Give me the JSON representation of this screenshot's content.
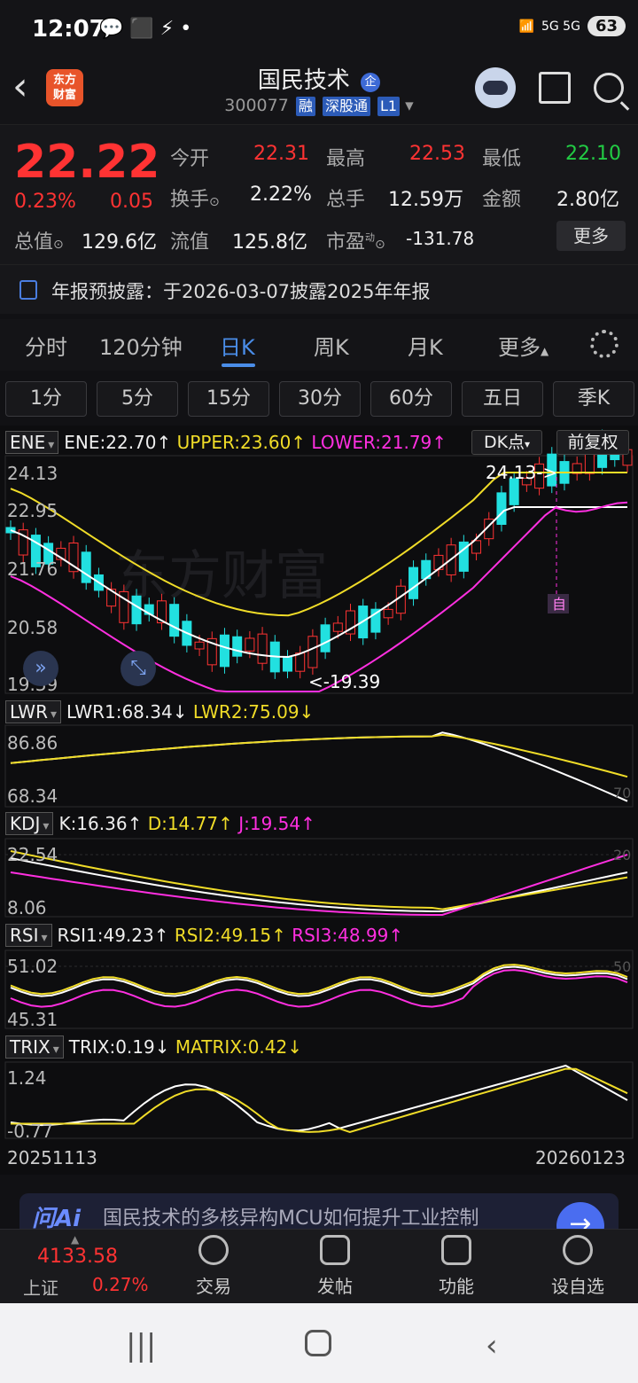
{
  "status_bar": {
    "time": "12:07",
    "left_icons": "💬 ⬛ ⚡ •",
    "network": "5G 5G",
    "battery": "63"
  },
  "header": {
    "logo_line1": "东方",
    "logo_line2": "财富",
    "stock_name": "国民技术",
    "stock_badge": "企",
    "stock_code": "300077",
    "tags": [
      "融",
      "深股通",
      "L1"
    ]
  },
  "quote": {
    "price": "22.22",
    "change_pct": "0.23%",
    "change": "0.05",
    "open_label": "今开",
    "open": "22.31",
    "high_label": "最高",
    "high": "22.53",
    "low_label": "最低",
    "low": "22.10",
    "turnover_label": "换手",
    "turnover": "2.22%",
    "volume_label": "总手",
    "volume": "12.59万",
    "amount_label": "金额",
    "amount": "2.80亿",
    "mcap_label": "总值",
    "mcap": "129.6亿",
    "float_label": "流值",
    "float": "125.8亿",
    "pe_label": "市盈",
    "pe_sup": "动",
    "pe": "-131.78",
    "more": "更多"
  },
  "notice": {
    "text": "年报预披露：于2026-03-07披露2025年年报"
  },
  "tabs": [
    "分时",
    "120分钟",
    "日K",
    "周K",
    "月K",
    "更多"
  ],
  "active_tab": "日K",
  "periods": [
    "1分",
    "5分",
    "15分",
    "30分",
    "60分",
    "五日",
    "季K"
  ],
  "indicators": {
    "ene": {
      "name": "ENE",
      "ene": "ENE:22.70↑",
      "upper": "UPPER:23.60↑",
      "lower": "LOWER:21.79↑",
      "dk": "DK点",
      "fq": "前复权"
    },
    "lwr": {
      "name": "LWR",
      "lwr1": "LWR1:68.34↓",
      "lwr2": "LWR2:75.09↓"
    },
    "kdj": {
      "name": "KDJ",
      "k": "K:16.36↑",
      "d": "D:14.77↑",
      "j": "J:19.54↑"
    },
    "rsi": {
      "name": "RSI",
      "rsi1": "RSI1:49.23↑",
      "rsi2": "RSI2:49.15↑",
      "rsi3": "RSI3:48.99↑"
    },
    "trix": {
      "name": "TRIX",
      "trix": "TRIX:0.19↓",
      "matrix": "MATRIX:0.42↓"
    }
  },
  "axis": {
    "price": [
      "24.13",
      "22.95",
      "21.76",
      "20.58",
      "19.39"
    ],
    "lwr": [
      "86.86",
      "68.34"
    ],
    "lwr_right": "70",
    "kdj": [
      "22.54",
      "8.06"
    ],
    "kdj_right": "20",
    "rsi": [
      "51.02",
      "45.31"
    ],
    "rsi_right": "50",
    "trix": [
      "1.24",
      "-0.77"
    ],
    "date_start": "20251113",
    "date_end": "20260123",
    "max_label": "24.13->",
    "min_label": "<-19.39",
    "self_marker": "自",
    "watermark": "东方财富"
  },
  "ai": {
    "logo": "问Ai",
    "text": "国民技术的多核异构MCU如何提升工业控制"
  },
  "bottom": {
    "index_value": "4133.58",
    "index_name": "上证",
    "index_pct": "0.27%",
    "nav": [
      "交易",
      "发帖",
      "功能",
      "设自选"
    ]
  },
  "colors": {
    "up": "#ff3333",
    "down": "#22e0e0",
    "upper": "#f0dc28",
    "lower": "#ff2fe0",
    "mid": "#ffffff"
  }
}
